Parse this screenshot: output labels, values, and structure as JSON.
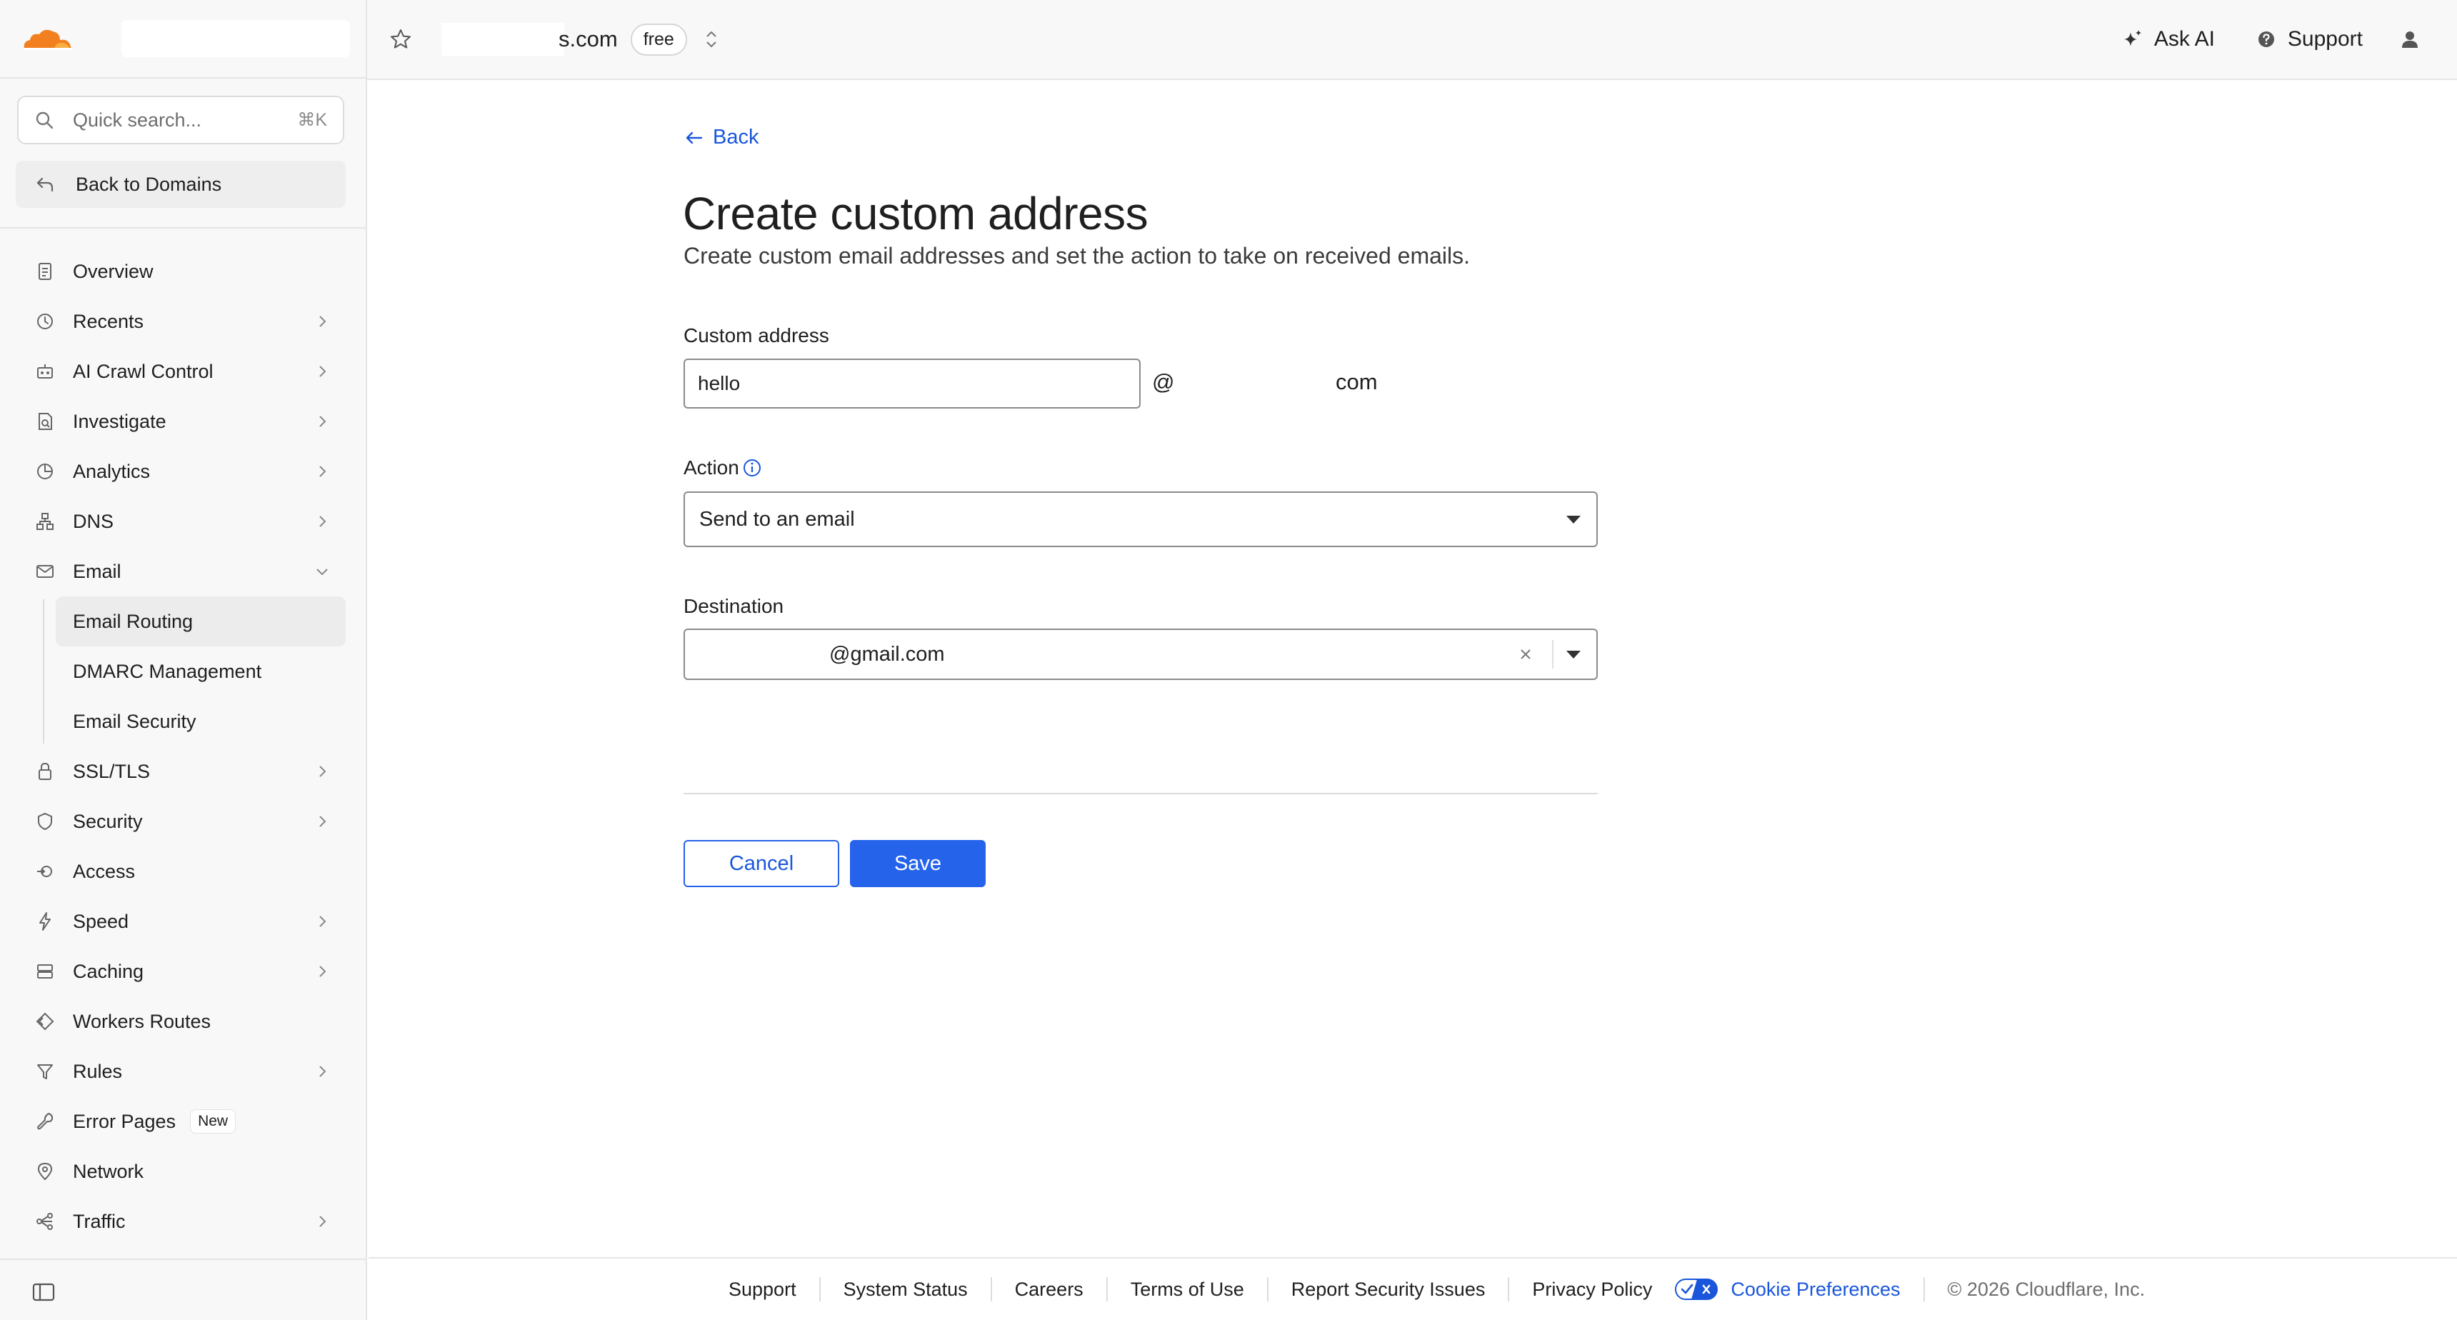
{
  "brand": {
    "accent": "#f38020",
    "primary_blue": "#2563eb"
  },
  "sidebar": {
    "search_placeholder": "Quick search...",
    "search_shortcut": "⌘K",
    "back_label": "Back to Domains",
    "items": [
      {
        "label": "Overview",
        "icon": "document-icon",
        "chevron": false
      },
      {
        "label": "Recents",
        "icon": "clock-icon",
        "chevron": true
      },
      {
        "label": "AI Crawl Control",
        "icon": "robot-icon",
        "chevron": true
      },
      {
        "label": "Investigate",
        "icon": "file-search-icon",
        "chevron": true
      },
      {
        "label": "Analytics",
        "icon": "pie-chart-icon",
        "chevron": true
      },
      {
        "label": "DNS",
        "icon": "network-tree-icon",
        "chevron": true
      },
      {
        "label": "Email",
        "icon": "mail-icon",
        "chevron": "open"
      }
    ],
    "email_children": [
      "Email Routing",
      "DMARC Management",
      "Email Security"
    ],
    "items_after": [
      {
        "label": "SSL/TLS",
        "icon": "lock-icon",
        "chevron": true
      },
      {
        "label": "Security",
        "icon": "shield-icon",
        "chevron": true
      },
      {
        "label": "Access",
        "icon": "access-icon",
        "chevron": false
      },
      {
        "label": "Speed",
        "icon": "bolt-icon",
        "chevron": true
      },
      {
        "label": "Caching",
        "icon": "server-icon",
        "chevron": true
      },
      {
        "label": "Workers Routes",
        "icon": "diamond-icon",
        "chevron": false
      },
      {
        "label": "Rules",
        "icon": "funnel-icon",
        "chevron": true
      },
      {
        "label": "Error Pages",
        "icon": "wrench-icon",
        "chevron": false,
        "badge": "New"
      },
      {
        "label": "Network",
        "icon": "pin-icon",
        "chevron": false
      },
      {
        "label": "Traffic",
        "icon": "share-icon",
        "chevron": true
      }
    ]
  },
  "topbar": {
    "zone_suffix": "s.com",
    "plan": "free",
    "ask_ai": "Ask AI",
    "support": "Support"
  },
  "main": {
    "back": "Back",
    "title": "Create custom address",
    "subtitle": "Create custom email addresses and set the action to take on received emails.",
    "custom_address_label": "Custom address",
    "custom_address_value": "hello",
    "at": "@",
    "domain_tail": "com",
    "action_label": "Action",
    "action_value": "Send to an email",
    "destination_label": "Destination",
    "destination_value": "@gmail.com",
    "cancel": "Cancel",
    "save": "Save"
  },
  "footer": {
    "links": [
      "Support",
      "System Status",
      "Careers",
      "Terms of Use",
      "Report Security Issues",
      "Privacy Policy"
    ],
    "cookie": "Cookie Preferences",
    "copyright": "© 2026 Cloudflare, Inc."
  }
}
